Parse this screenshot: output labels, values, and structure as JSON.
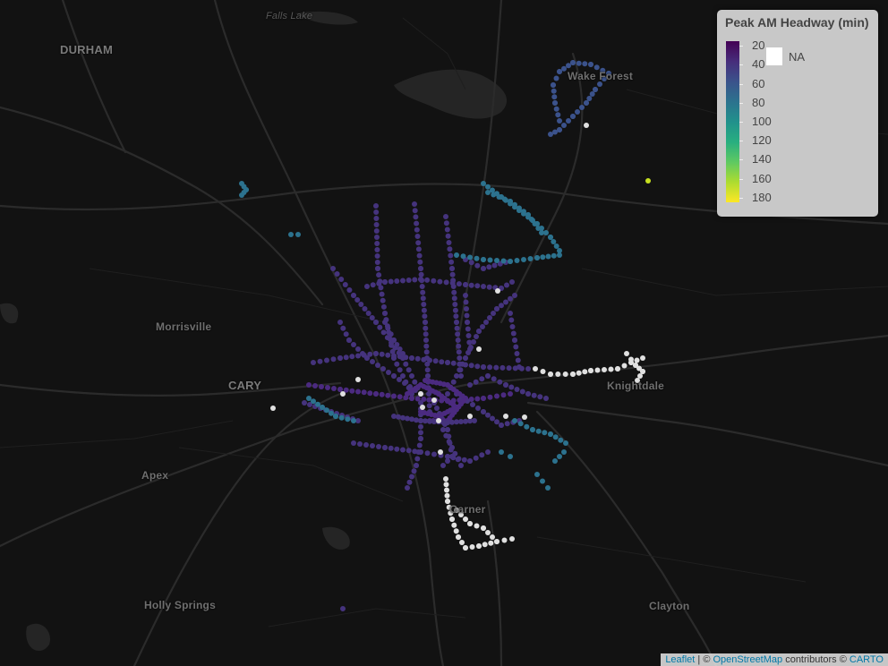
{
  "legend": {
    "title": "Peak AM Headway (min)",
    "ticks": [
      "20",
      "40",
      "60",
      "80",
      "100",
      "120",
      "140",
      "160",
      "180"
    ],
    "na_label": "NA",
    "scale_min": 15,
    "scale_max": 185,
    "colors": [
      "#440154",
      "#472d7b",
      "#3b528b",
      "#2c728e",
      "#21918c",
      "#28ae80",
      "#5ec962",
      "#addc30",
      "#fde725"
    ],
    "na_color": "#ffffff"
  },
  "places": {
    "durham": "DURHAM",
    "falls_lake": "Falls Lake",
    "wake_forest": "Wake Forest",
    "morrisville": "Morrisville",
    "cary": "CARY",
    "apex": "Apex",
    "knightdale": "Knightdale",
    "garner": "Garner",
    "holly_springs": "Holly Springs",
    "clayton": "Clayton"
  },
  "attribution": {
    "leaflet": "Leaflet",
    "sep1": " | © ",
    "osm": "OpenStreetMap",
    "mid": " contributors © ",
    "carto": "CARTO"
  }
}
